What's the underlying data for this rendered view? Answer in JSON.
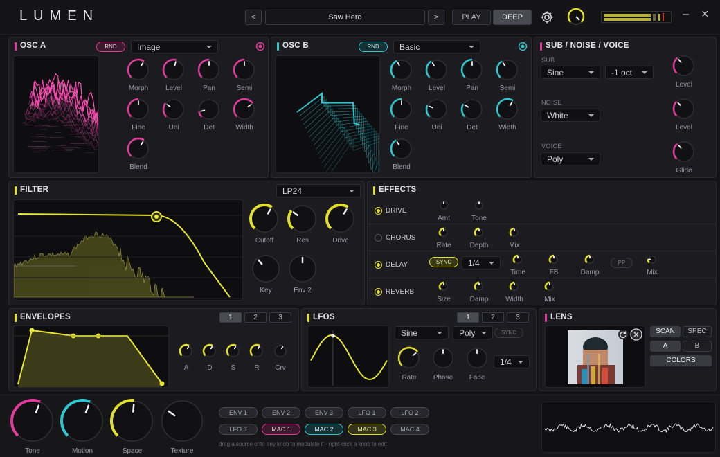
{
  "app": {
    "logo": "LUMEN"
  },
  "topbar": {
    "prev": "<",
    "preset": "Saw Hero",
    "next": ">",
    "play": "PLAY",
    "deep": "DEEP",
    "minimize": "–",
    "close": "×"
  },
  "colors": {
    "pink": "#e23a9b",
    "cyan": "#2fc6cf",
    "yellow": "#e2df2b",
    "bg": "#1c1c20"
  },
  "osc_a": {
    "title": "OSC A",
    "rnd": "RND",
    "mode": "Image",
    "knobs": [
      {
        "label": "Morph",
        "value": 0.62
      },
      {
        "label": "Level",
        "value": 0.55
      },
      {
        "label": "Pan",
        "value": 0.5
      },
      {
        "label": "Semi",
        "value": 0.5
      },
      {
        "label": "Fine",
        "value": 0.5
      },
      {
        "label": "Uni",
        "value": 0.3
      },
      {
        "label": "Det",
        "value": 0.12
      },
      {
        "label": "Width",
        "value": 0.7
      },
      {
        "label": "Blend",
        "value": 0.62
      }
    ]
  },
  "osc_b": {
    "title": "OSC B",
    "rnd": "RND",
    "mode": "Basic",
    "knobs": [
      {
        "label": "Morph",
        "value": 0.4
      },
      {
        "label": "Level",
        "value": 0.38
      },
      {
        "label": "Pan",
        "value": 0.5
      },
      {
        "label": "Semi",
        "value": 0.38
      },
      {
        "label": "Fine",
        "value": 0.5
      },
      {
        "label": "Uni",
        "value": 0.25
      },
      {
        "label": "Det",
        "value": 0.28
      },
      {
        "label": "Width",
        "value": 0.62
      },
      {
        "label": "Blend",
        "value": 0.38
      }
    ]
  },
  "sub": {
    "title": "SUB / NOISE / VOICE",
    "sub_label": "SUB",
    "sub_wave": "Sine",
    "sub_oct": "-1 oct",
    "noise_label": "NOISE",
    "noise_type": "White",
    "voice_label": "VOICE",
    "voice_mode": "Poly",
    "knobs": [
      {
        "label": "Level",
        "value": 0.35
      },
      {
        "label": "Level",
        "value": 0.33
      },
      {
        "label": "Glide",
        "value": 0.35
      }
    ]
  },
  "filter": {
    "title": "FILTER",
    "type": "LP24",
    "knobs": [
      {
        "label": "Cutoff",
        "value": 0.62
      },
      {
        "label": "Res",
        "value": 0.3
      },
      {
        "label": "Drive",
        "value": 0.62
      },
      {
        "label": "Key",
        "value": 0.35
      },
      {
        "label": "Env 2",
        "value": 0.5
      }
    ]
  },
  "effects": {
    "title": "EFFECTS",
    "rows": [
      {
        "name": "DRIVE",
        "on": true,
        "knobs": [
          {
            "label": "Amt"
          },
          {
            "label": "Tone"
          }
        ]
      },
      {
        "name": "CHORUS",
        "on": false,
        "knobs": [
          {
            "label": "Rate"
          },
          {
            "label": "Depth"
          },
          {
            "label": "Mix"
          }
        ]
      },
      {
        "name": "DELAY",
        "on": true,
        "sync": "SYNC",
        "div": "1/4",
        "knobs": [
          {
            "label": "Time"
          },
          {
            "label": "FB"
          },
          {
            "label": "Damp"
          }
        ],
        "pp": "PP",
        "mix": "Mix"
      },
      {
        "name": "REVERB",
        "on": true,
        "knobs": [
          {
            "label": "Size"
          },
          {
            "label": "Damp"
          },
          {
            "label": "Width"
          },
          {
            "label": "Mix"
          }
        ]
      }
    ]
  },
  "envelopes": {
    "title": "ENVELOPES",
    "tabs": [
      "1",
      "2",
      "3"
    ],
    "knobs": [
      {
        "label": "A"
      },
      {
        "label": "D"
      },
      {
        "label": "S"
      },
      {
        "label": "R"
      },
      {
        "label": "Crv"
      }
    ]
  },
  "lfos": {
    "title": "LFOS",
    "tabs": [
      "1",
      "2",
      "3"
    ],
    "wave": "Sine",
    "mode": "Poly",
    "sync": "SYNC",
    "div": "1/4",
    "knobs": [
      {
        "label": "Rate",
        "value": 0.7
      },
      {
        "label": "Phase",
        "value": 0.5
      },
      {
        "label": "Fade",
        "value": 0.5
      }
    ]
  },
  "lens": {
    "title": "LENS",
    "scan": "SCAN",
    "spec": "SPEC",
    "a": "A",
    "b": "B",
    "colors": "COLORS"
  },
  "macros": {
    "knobs": [
      {
        "label": "Tone",
        "value": 0.58
      },
      {
        "label": "Motion",
        "value": 0.58
      },
      {
        "label": "Space",
        "value": 0.52
      },
      {
        "label": "Texture",
        "value": 0.3
      }
    ],
    "mod_sources": [
      [
        "ENV 1",
        "ENV 2",
        "ENV 3",
        "LFO 1",
        "LFO 2"
      ],
      [
        "LFO 3",
        "MAC 1",
        "MAC 2",
        "MAC 3",
        "MAC 4"
      ]
    ],
    "hint": "drag a source onto any knob to modulate it · right-click a knob to edit"
  }
}
